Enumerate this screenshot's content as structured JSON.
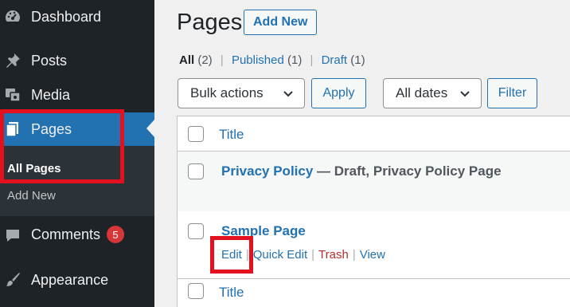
{
  "sidebar": {
    "items": [
      {
        "label": "Dashboard",
        "icon": "dashboard-icon"
      },
      {
        "label": "Posts",
        "icon": "pushpin-icon"
      },
      {
        "label": "Media",
        "icon": "media-icon"
      },
      {
        "label": "Pages",
        "icon": "pages-icon"
      },
      {
        "label": "Comments",
        "icon": "comment-icon",
        "badge": "5"
      },
      {
        "label": "Appearance",
        "icon": "paintbrush-icon"
      }
    ],
    "submenu": {
      "all_pages": "All Pages",
      "add_new": "Add New"
    }
  },
  "header": {
    "title": "Pages",
    "add_new": "Add New"
  },
  "filters": {
    "all_label": "All",
    "all_count": "(2)",
    "published_label": "Published",
    "published_count": "(1)",
    "draft_label": "Draft",
    "draft_count": "(1)",
    "separator": "|"
  },
  "toolbar": {
    "bulk_actions": "Bulk actions",
    "apply": "Apply",
    "all_dates": "All dates",
    "filter": "Filter"
  },
  "table": {
    "column_title": "Title",
    "rows": [
      {
        "title": "Privacy Policy",
        "state": " — Draft, Privacy Policy Page"
      },
      {
        "title": "Sample Page",
        "actions": {
          "edit": "Edit",
          "quick_edit": "Quick Edit",
          "trash": "Trash",
          "view": "View"
        }
      }
    ],
    "footer_title": "Title"
  },
  "colors": {
    "sidebar_bg": "#1d2327",
    "accent": "#2271b1",
    "highlight": "#e3101d",
    "badge": "#d63638",
    "trash": "#b32d2e"
  }
}
